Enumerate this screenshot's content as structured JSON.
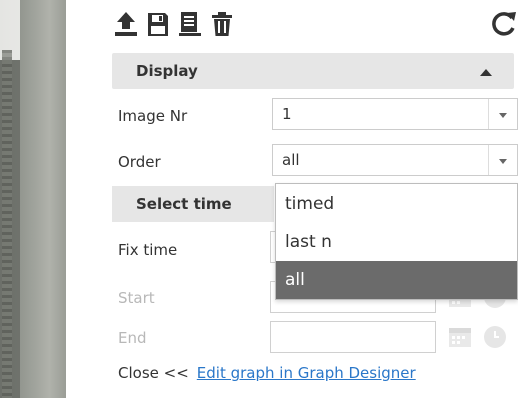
{
  "toolbar": {
    "icons": [
      "upload-icon",
      "save-icon",
      "list-icon",
      "trash-icon",
      "refresh-icon"
    ]
  },
  "display_section": {
    "title": "Display"
  },
  "image_nr": {
    "label": "Image Nr",
    "value": "1"
  },
  "order": {
    "label": "Order",
    "value": "all",
    "options": [
      "timed",
      "last n",
      "all"
    ],
    "selected": "all"
  },
  "time_section": {
    "title": "Select time"
  },
  "fix_time": {
    "label": "Fix time"
  },
  "start": {
    "label": "Start"
  },
  "end": {
    "label": "End"
  },
  "footer": {
    "close_label": "Close <<",
    "edit_link": "Edit graph in Graph Designer"
  },
  "colors": {
    "header_bg": "#e6e6e6",
    "selected_option_bg": "#6b6b6b",
    "link": "#2a77c9",
    "disabled_text": "#b8b8b8"
  }
}
